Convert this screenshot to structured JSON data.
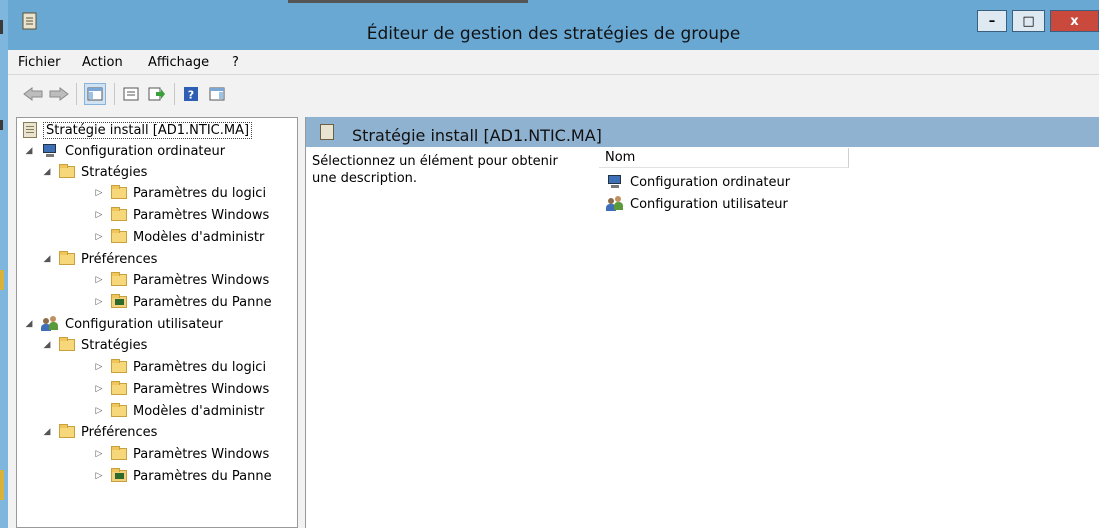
{
  "window": {
    "title": "Éditeur de gestion des stratégies de groupe",
    "controls": {
      "minimize": "–",
      "maximize": "□",
      "close": "x"
    }
  },
  "menu": [
    "Fichier",
    "Action",
    "Affichage",
    "?"
  ],
  "toolbar": {
    "buttons": [
      "back-arrow-icon",
      "forward-arrow-icon",
      "show-hide-tree-icon",
      "properties-icon",
      "export-list-icon",
      "help-icon",
      "show-action-pane-icon"
    ]
  },
  "tree": {
    "root": "Stratégie install [AD1.NTIC.MA]",
    "computer": {
      "label": "Configuration ordinateur",
      "strategies": "Stratégies",
      "s1": "Paramètres du logici",
      "s2": "Paramètres Windows",
      "s3": "Modèles d'administr",
      "preferences": "Préférences",
      "p1": "Paramètres Windows",
      "p2": "Paramètres du Panne"
    },
    "user": {
      "label": "Configuration utilisateur",
      "strategies": "Stratégies",
      "s1": "Paramètres du logici",
      "s2": "Paramètres Windows",
      "s3": "Modèles d'administr",
      "preferences": "Préférences",
      "p1": "Paramètres Windows",
      "p2": "Paramètres du Panne"
    }
  },
  "details": {
    "title": "Stratégie install [AD1.NTIC.MA]",
    "description_line1": "Sélectionnez un élément pour obtenir",
    "description_line2": "une description.",
    "column": "Nom",
    "items": [
      "Configuration ordinateur",
      "Configuration utilisateur"
    ]
  }
}
